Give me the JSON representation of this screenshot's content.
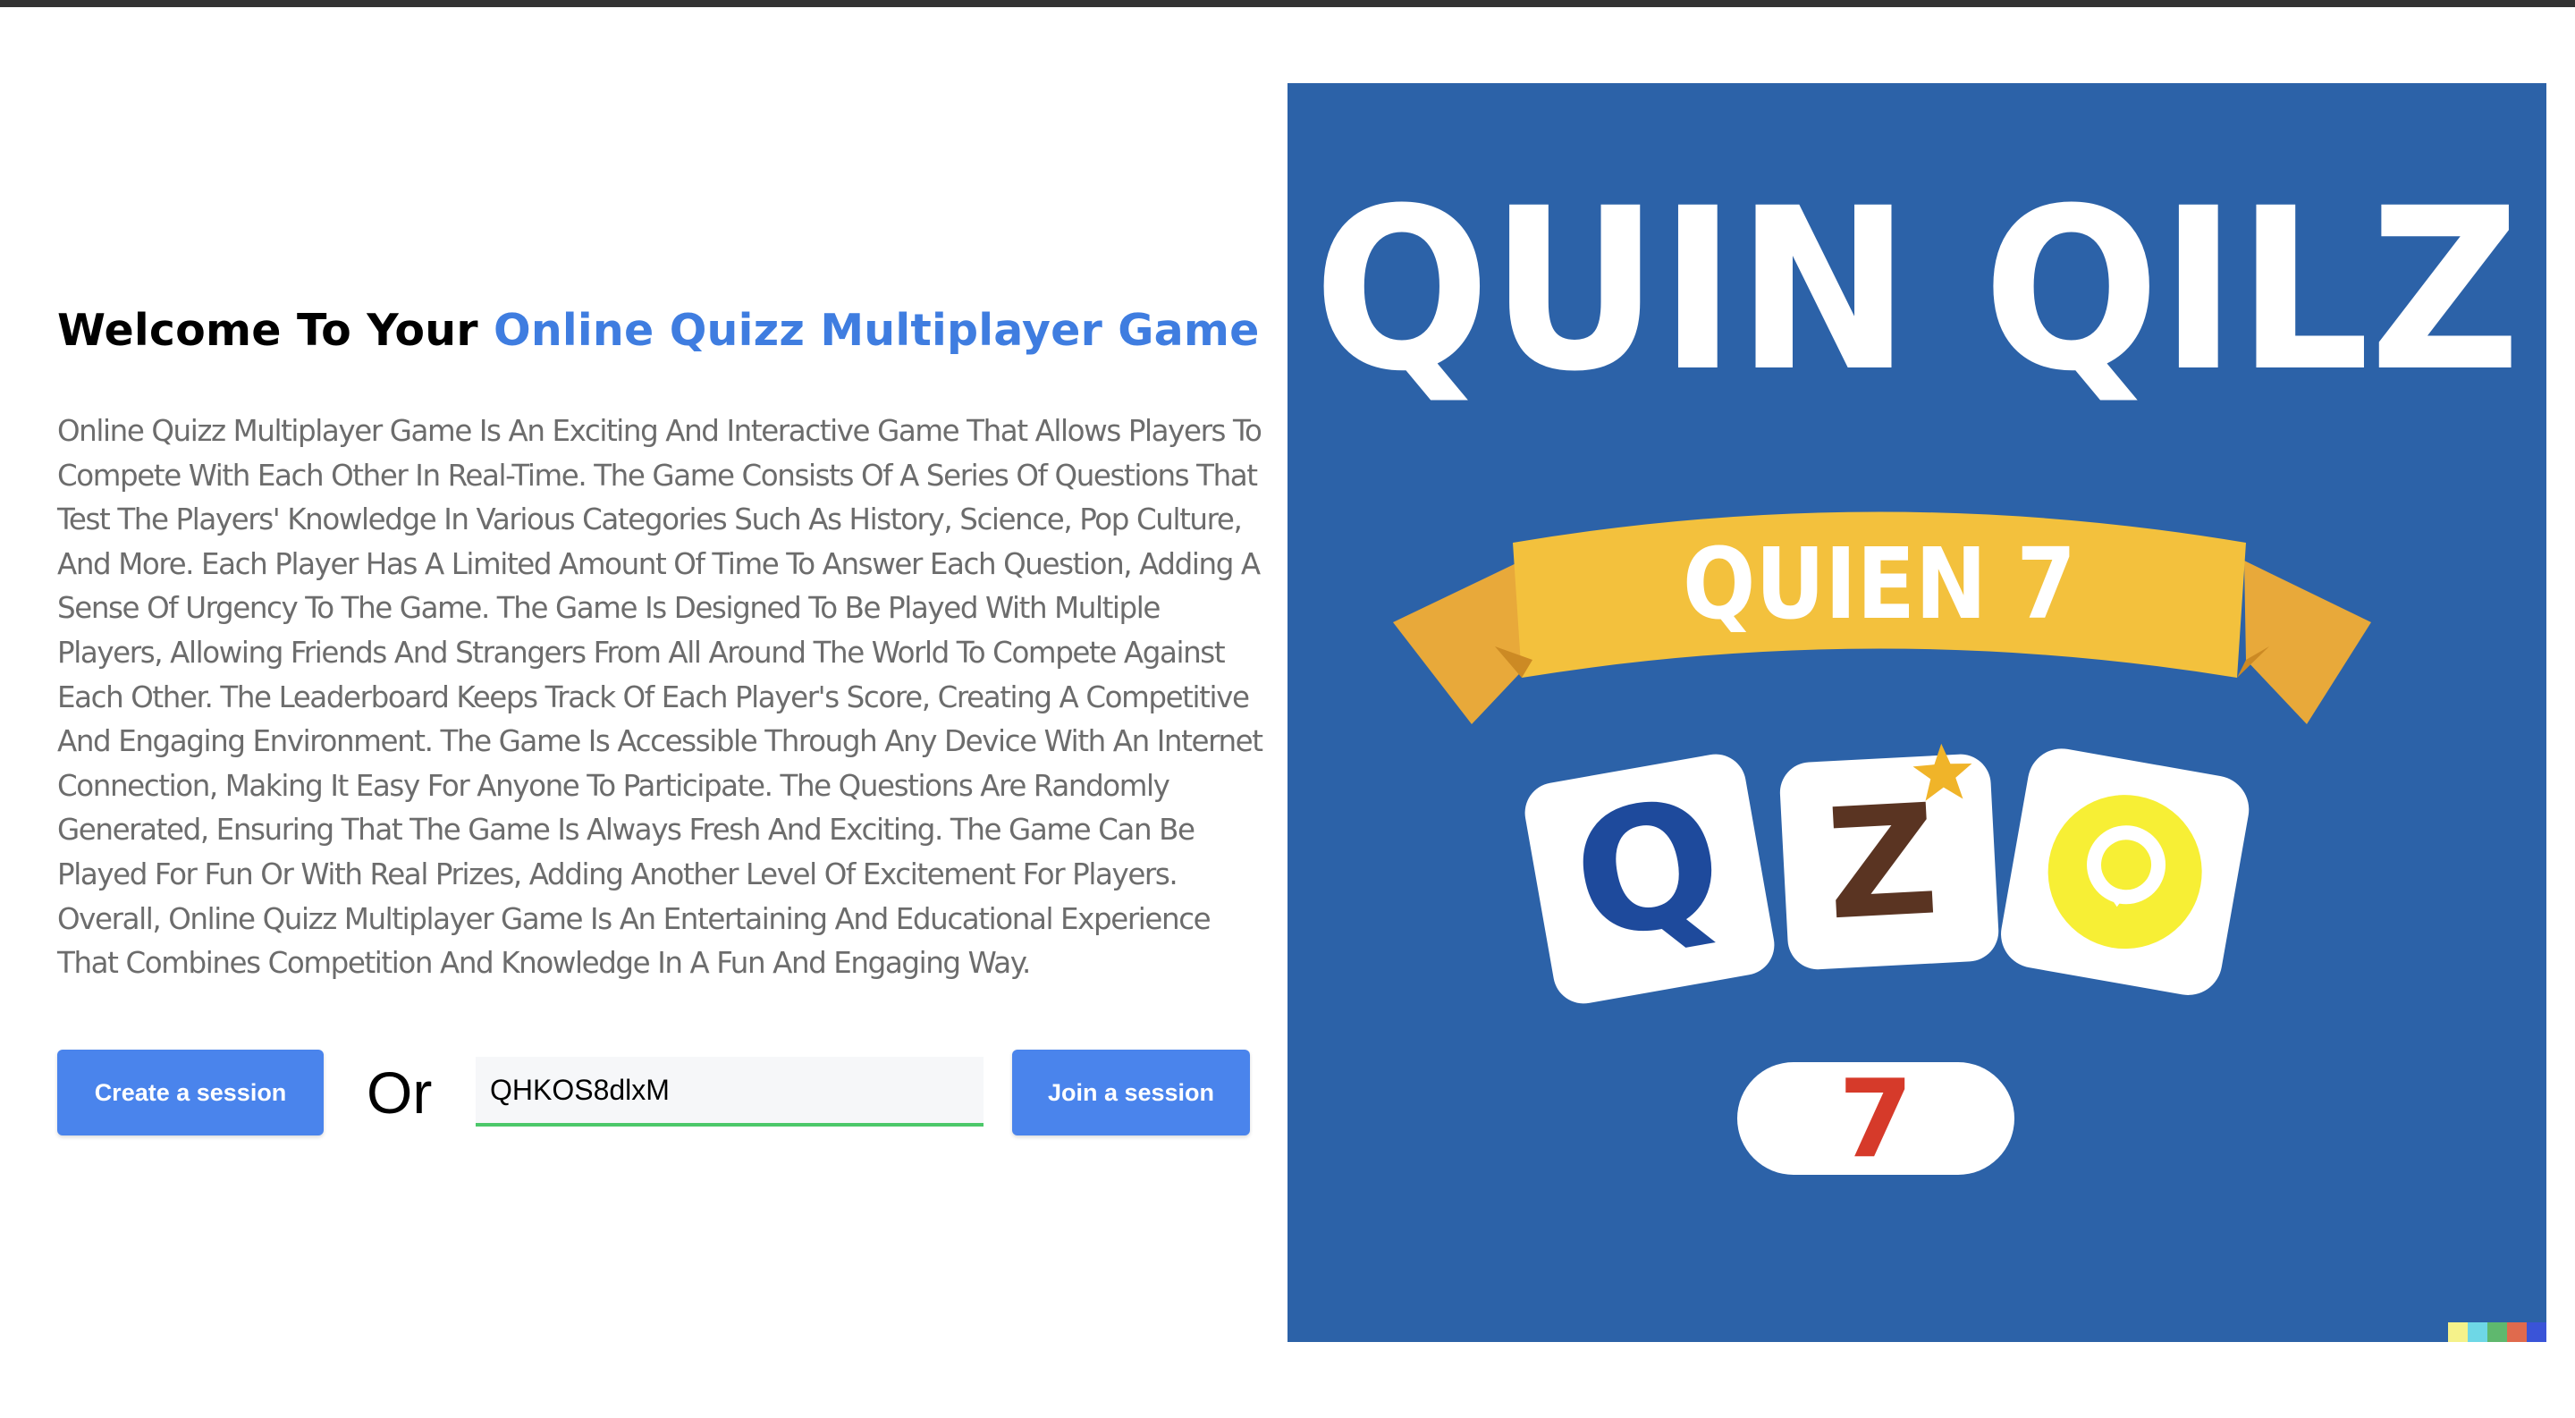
{
  "header": {
    "title_prefix": "Welcome To Your ",
    "title_accent": "Online Quizz Multiplayer Game"
  },
  "description": "Online Quizz Multiplayer Game Is An Exciting And Interactive Game That Allows Players To Compete With Each Other In Real-Time. The Game Consists Of A Series Of Questions That Test The Players' Knowledge In Various Categories Such As History, Science, Pop Culture, And More. Each Player Has A Limited Amount Of Time To Answer Each Question, Adding A Sense Of Urgency To The Game. The Game Is Designed To Be Played With Multiple Players, Allowing Friends And Strangers From All Around The World To Compete Against Each Other. The Leaderboard Keeps Track Of Each Player's Score, Creating A Competitive And Engaging Environment. The Game Is Accessible Through Any Device With An Internet Connection, Making It Easy For Anyone To Participate. The Questions Are Randomly Generated, Ensuring That The Game Is Always Fresh And Exciting. The Game Can Be Played For Fun Or With Real Prizes, Adding Another Level Of Excitement For Players. Overall, Online Quizz Multiplayer Game Is An Entertaining And Educational Experience That Combines Competition And Knowledge In A Fun And Engaging Way.",
  "actions": {
    "create_label": "Create a session",
    "or_label": "Or",
    "session_code_value": "QHKOS8dlxM",
    "join_label": "Join a session"
  },
  "illustration": {
    "big_title": "QUIN QILZ",
    "banner_text": "QUIEN 7",
    "tiles": [
      "Q",
      "Z"
    ],
    "pill_text": "7"
  },
  "colors": {
    "accent": "#3f7de0",
    "button": "#4a84ec",
    "input_underline": "#4cc86a",
    "art_background": "#2c62a8",
    "banner": "#f3c13d"
  }
}
